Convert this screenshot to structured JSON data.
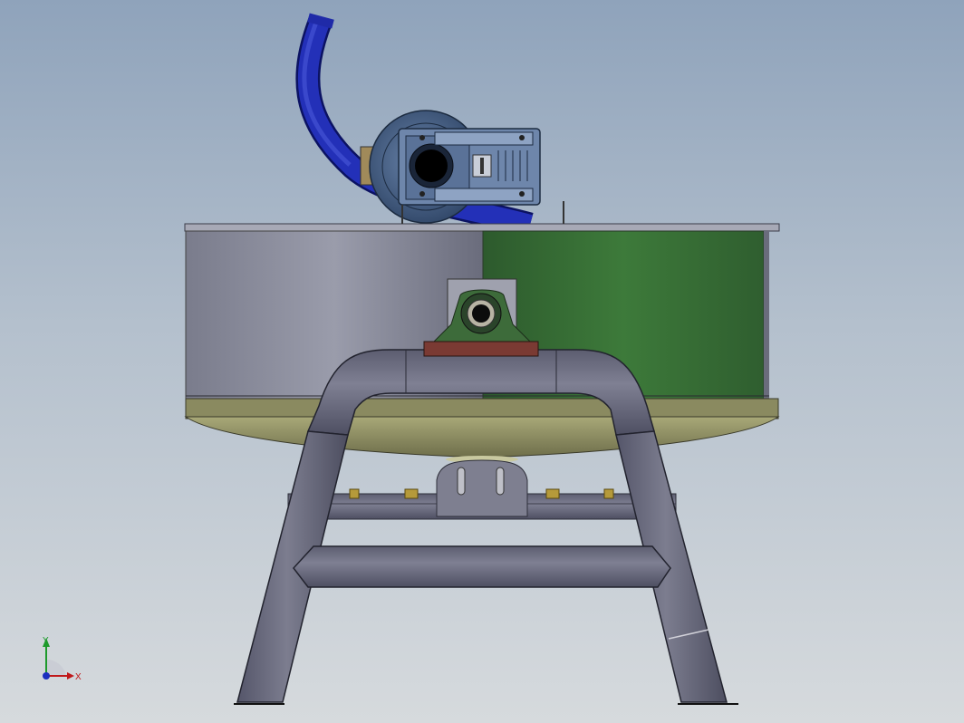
{
  "view": {
    "background_top": "#8fa3bb",
    "background_bottom": "#d6dadd",
    "model_parts": [
      "motor-gearbox",
      "flexible-hose",
      "drum-body",
      "pillow-block-bearing",
      "tube-frame-stand",
      "spray-bar"
    ]
  },
  "triad": {
    "x_label": "X",
    "y_label": "Y",
    "x_color": "#c0181b",
    "y_color": "#1e9a2c",
    "z_color": "#1b2fbf"
  },
  "colors": {
    "drum_grey": "#8e90a0",
    "drum_green": "#356a34",
    "frame": "#6f7080",
    "hose": "#1f2aa8",
    "gearbox": "#4d6890",
    "bearing_base": "#7a3a33",
    "drum_bottom": "#9a9a6a"
  }
}
